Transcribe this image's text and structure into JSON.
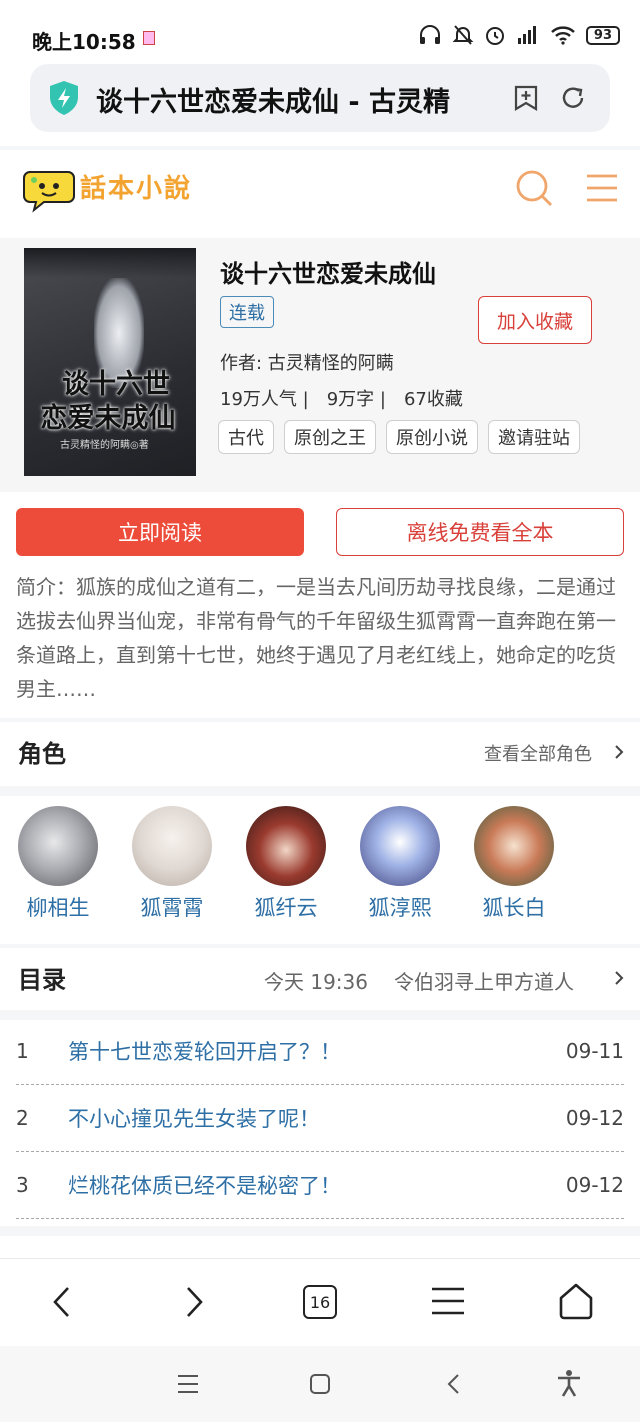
{
  "status_bar": {
    "time": "晚上10:58",
    "battery": "93"
  },
  "browser": {
    "tab_title": "谈十六世恋爱未成仙 - 古灵精",
    "tab_count": "16"
  },
  "site": {
    "logo_text": "話本小說"
  },
  "book": {
    "title": "谈十六世恋爱未成仙",
    "status": "连载",
    "favorite_label": "加入收藏",
    "author": "作者: 古灵精怪的阿瞒",
    "stats": [
      "19万人气 |",
      "9万字 |",
      "67收藏"
    ],
    "tags": [
      "古代",
      "原创之王",
      "原创小说",
      "邀请驻站"
    ],
    "cover": {
      "title_line1": "谈十六世",
      "title_line2": "恋爱未成仙",
      "author": "古灵精怪的阿瞒◎著"
    }
  },
  "actions": {
    "read": "立即阅读",
    "offline": "离线免费看全本"
  },
  "intro": "简介：狐族的成仙之道有二，一是当去凡间历劫寻找良缘，二是通过选拔去仙界当仙宠，非常有骨气的千年留级生狐霄霄一直奔跑在第一条道路上，直到第十七世，她终于遇见了月老红线上，她命定的吃货男主……",
  "characters": {
    "title": "角色",
    "view_all": "查看全部角色",
    "items": [
      {
        "name": "柳相生"
      },
      {
        "name": "狐霄霄"
      },
      {
        "name": "狐纤云"
      },
      {
        "name": "狐淳熙"
      },
      {
        "name": "狐长白"
      }
    ]
  },
  "toc": {
    "title": "目录",
    "latest_time": "今天 19:36",
    "latest_chapter": "令伯羽寻上甲方道人",
    "chapters": [
      {
        "num": "1",
        "title": "第十七世恋爱轮回开启了？！",
        "date": "09-11"
      },
      {
        "num": "2",
        "title": "不小心撞见先生女装了呢！",
        "date": "09-12"
      },
      {
        "num": "3",
        "title": "烂桃花体质已经不是秘密了！",
        "date": "09-12"
      }
    ]
  },
  "colors": {
    "accent_red": "#ed4c3a",
    "link_blue": "#2e6fa5",
    "logo_orange": "#f3a32f"
  }
}
